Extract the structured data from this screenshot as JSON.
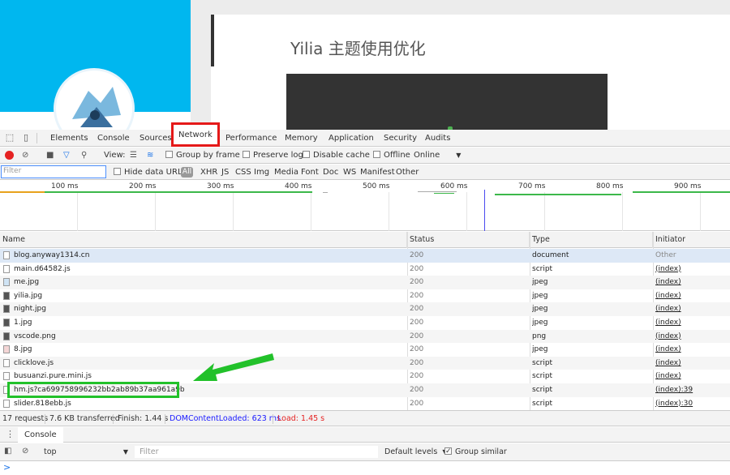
{
  "page": {
    "post_title": "Yilia 主题使用优化"
  },
  "devtools": {
    "tabs": [
      "Elements",
      "Console",
      "Sources",
      "Network",
      "Performance",
      "Memory",
      "Application",
      "Security",
      "Audits"
    ],
    "active_tab": "Network",
    "toolbar": {
      "view_label": "View:",
      "group_by_frame": "Group by frame",
      "preserve_log": "Preserve log",
      "disable_cache": "Disable cache",
      "offline": "Offline",
      "online": "Online"
    },
    "filterbar": {
      "filter_placeholder": "Filter",
      "hide_data_urls": "Hide data URLs",
      "all": "All",
      "types": [
        "XHR",
        "JS",
        "CSS",
        "Img",
        "Media",
        "Font",
        "Doc",
        "WS",
        "Manifest",
        "Other"
      ]
    },
    "timeline_ticks": [
      "100 ms",
      "200 ms",
      "300 ms",
      "400 ms",
      "500 ms",
      "600 ms",
      "700 ms",
      "800 ms",
      "900 ms"
    ],
    "columns": [
      "Name",
      "Status",
      "Type",
      "Initiator"
    ],
    "requests": [
      {
        "name": "blog.anyway1314.cn",
        "status": "200",
        "type": "document",
        "initiator": "Other"
      },
      {
        "name": "main.d64582.js",
        "status": "200",
        "type": "script",
        "initiator": "(index)"
      },
      {
        "name": "me.jpg",
        "status": "200",
        "type": "jpeg",
        "initiator": "(index)"
      },
      {
        "name": "yilia.jpg",
        "status": "200",
        "type": "jpeg",
        "initiator": "(index)"
      },
      {
        "name": "night.jpg",
        "status": "200",
        "type": "jpeg",
        "initiator": "(index)"
      },
      {
        "name": "1.jpg",
        "status": "200",
        "type": "jpeg",
        "initiator": "(index)"
      },
      {
        "name": "vscode.png",
        "status": "200",
        "type": "png",
        "initiator": "(index)"
      },
      {
        "name": "8.jpg",
        "status": "200",
        "type": "jpeg",
        "initiator": "(index)"
      },
      {
        "name": "clicklove.js",
        "status": "200",
        "type": "script",
        "initiator": "(index)"
      },
      {
        "name": "busuanzi.pure.mini.js",
        "status": "200",
        "type": "script",
        "initiator": "(index)"
      },
      {
        "name": "hm.js?ca699758996232bb2ab89b37aa961a9b",
        "status": "200",
        "type": "script",
        "initiator": "(index):39"
      },
      {
        "name": "slider.818ebb.js",
        "status": "200",
        "type": "script",
        "initiator": "(index):30"
      }
    ],
    "summary": {
      "requests": "17 requests",
      "transferred": "7.6 KB transferred",
      "finish": "Finish: 1.44 s",
      "dom": "DOMContentLoaded: 623 ms",
      "load": "Load: 1.45 s"
    },
    "drawer": {
      "tab": "Console",
      "context": "top",
      "filter_placeholder": "Filter",
      "levels": "Default levels",
      "group_similar": "Group similar",
      "prompt": ">"
    },
    "colors": {
      "highlight_red": "#e51919",
      "highlight_green": "#22c12a",
      "dom_blue": "#1a1aff",
      "load_red": "#e52222"
    }
  }
}
